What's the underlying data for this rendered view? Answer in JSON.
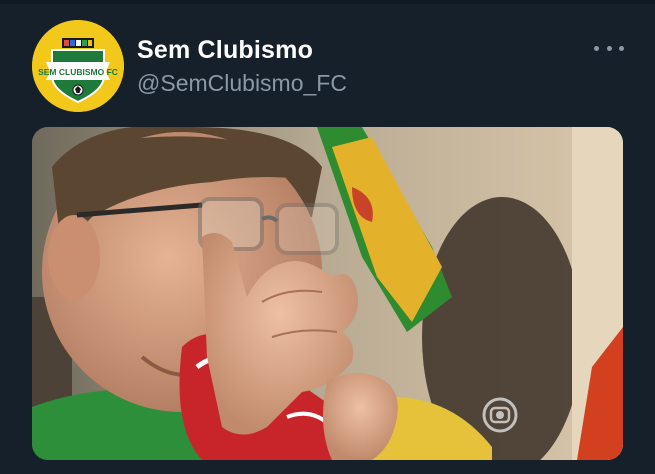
{
  "tweet": {
    "display_name": "Sem Clubismo",
    "handle": "@SemClubismo_FC",
    "avatar": {
      "logo_text": "SEM CLUBISMO FC",
      "background_color": "#f2c81b",
      "shield_color": "#1e7a3a"
    },
    "more_icon": "more-horizontal-icon",
    "media": {
      "type": "photo",
      "watermark_icon": "tv-globo-watermark-icon"
    }
  },
  "theme": {
    "background": "#15202b",
    "secondary_text": "#8b98a5"
  }
}
